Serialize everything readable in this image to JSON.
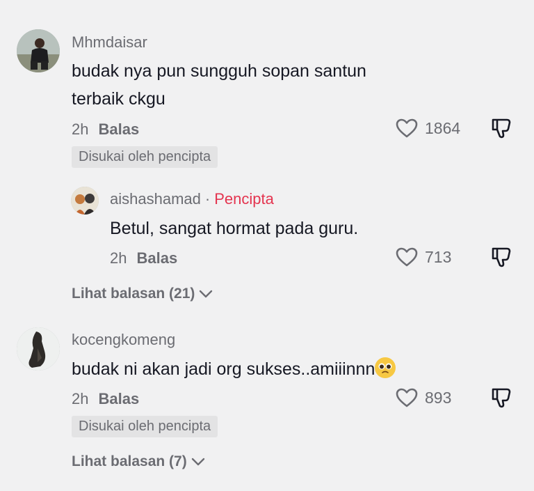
{
  "comments": [
    {
      "username": "Mhmdaisar",
      "text_line1": "budak nya pun sungguh sopan santun",
      "text_line2": "terbaik ckgu",
      "time": "2h",
      "reply_label": "Balas",
      "likes": "1864",
      "badge": "Disukai oleh pencipta",
      "replies": [
        {
          "username": "aishashamad",
          "separator": "·",
          "creator_label": "Pencipta",
          "text": "Betul, sangat hormat pada guru.",
          "time": "2h",
          "reply_label": "Balas",
          "likes": "713"
        }
      ],
      "view_replies": "Lihat balasan (21)"
    },
    {
      "username": "kocengkomeng",
      "text": "budak ni akan jadi org sukses..amiiinnn",
      "emoji": "pleading-face-emoji",
      "time": "2h",
      "reply_label": "Balas",
      "likes": "893",
      "badge": "Disukai oleh pencipta",
      "view_replies": "Lihat balasan (7)"
    }
  ],
  "icons": {
    "like": "heart-outline-icon",
    "dislike": "thumbs-down-outline-icon",
    "expand": "chevron-down-icon"
  },
  "colors": {
    "background": "#f1f1f2",
    "secondary_text": "#6b6c72",
    "creator_accent": "#e4344f",
    "badge_bg": "#e3e3e4"
  }
}
